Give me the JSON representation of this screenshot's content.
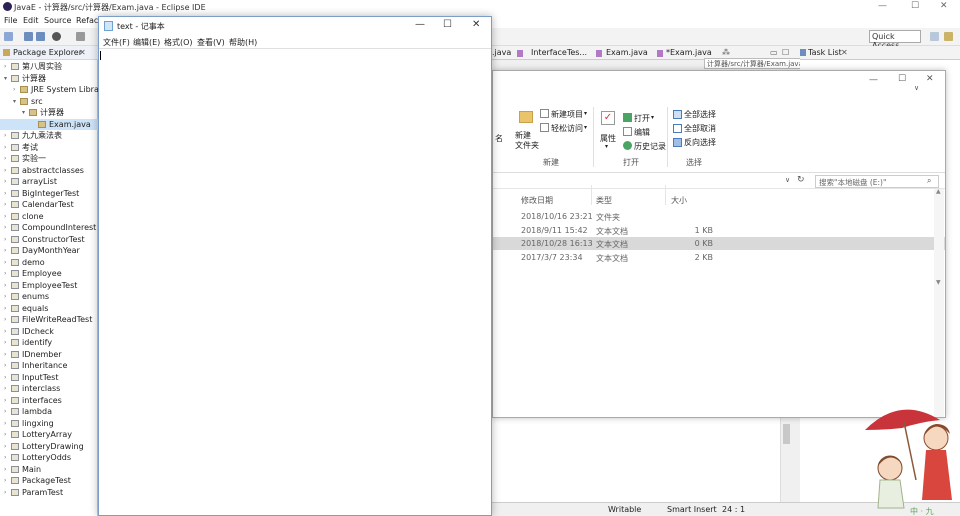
{
  "eclipse": {
    "title": "JavaE - 计算器/src/计算器/Exam.java - Eclipse IDE",
    "menu": [
      "File",
      "Edit",
      "Source",
      "Refac"
    ],
    "quick_access": "Quick Access",
    "package_explorer": {
      "title": "Package Explorer",
      "tree": [
        {
          "label": "第八周实验",
          "level": 0,
          "expanded": false
        },
        {
          "label": "计算器",
          "level": 0,
          "expanded": true
        },
        {
          "label": "JRE System Librar",
          "level": 1,
          "expanded": false
        },
        {
          "label": "src",
          "level": 1,
          "expanded": true
        },
        {
          "label": "计算器",
          "level": 2,
          "expanded": true
        },
        {
          "label": "Exam.java",
          "level": 3,
          "expanded": false,
          "selected": true
        },
        {
          "label": "九九乘法表",
          "level": 0
        },
        {
          "label": "考试",
          "level": 0
        },
        {
          "label": "实验一",
          "level": 0
        },
        {
          "label": "abstractclasses",
          "level": 0
        },
        {
          "label": "arrayList",
          "level": 0
        },
        {
          "label": "BigIntegerTest",
          "level": 0
        },
        {
          "label": "CalendarTest",
          "level": 0
        },
        {
          "label": "clone",
          "level": 0
        },
        {
          "label": "CompoundInterest",
          "level": 0
        },
        {
          "label": "ConstructorTest",
          "level": 0
        },
        {
          "label": "DayMonthYear",
          "level": 0
        },
        {
          "label": "demo",
          "level": 0
        },
        {
          "label": "Employee",
          "level": 0
        },
        {
          "label": "EmployeeTest",
          "level": 0
        },
        {
          "label": "enums",
          "level": 0
        },
        {
          "label": "equals",
          "level": 0
        },
        {
          "label": "FileWriteReadTest",
          "level": 0
        },
        {
          "label": "IDcheck",
          "level": 0
        },
        {
          "label": "identify",
          "level": 0
        },
        {
          "label": "IDnember",
          "level": 0
        },
        {
          "label": "Inheritance",
          "level": 0
        },
        {
          "label": "InputTest",
          "level": 0
        },
        {
          "label": "interclass",
          "level": 0
        },
        {
          "label": "interfaces",
          "level": 0
        },
        {
          "label": "lambda",
          "level": 0
        },
        {
          "label": "lingxing",
          "level": 0
        },
        {
          "label": "LotteryArray",
          "level": 0
        },
        {
          "label": "LotteryDrawing",
          "level": 0
        },
        {
          "label": "LotteryOdds",
          "level": 0
        },
        {
          "label": "Main",
          "level": 0
        },
        {
          "label": "PackageTest",
          "level": 0
        },
        {
          "label": "ParamTest",
          "level": 0
        }
      ]
    },
    "editor_tabs": [
      ".java",
      "InterfaceTes...",
      "Exam.java",
      "*Exam.java"
    ],
    "breadcrumb": "计算器/src/计算器/Exam.java",
    "task_list": "Task List",
    "status": {
      "writable": "Writable",
      "insert": "Smart Insert",
      "position": "24 : 1"
    }
  },
  "explorer": {
    "ribbon": {
      "rename_partial": "名",
      "new_folder": "新建\n文件夹",
      "new_item": "新建项目",
      "easy_access": "轻松访问",
      "group_new": "新建",
      "properties": "属性",
      "open": "打开",
      "edit": "编辑",
      "history": "历史记录",
      "group_open": "打开",
      "select_all": "全部选择",
      "select_none": "全部取消",
      "invert": "反向选择",
      "group_select": "选择"
    },
    "search_placeholder": "搜索\"本地磁盘 (E:)\"",
    "columns": {
      "date": "修改日期",
      "type": "类型",
      "size": "大小"
    },
    "rows": [
      {
        "date": "2018/10/16 23:21",
        "type": "文件夹",
        "size": ""
      },
      {
        "date": "2018/9/11 15:42",
        "type": "文本文档",
        "size": "1 KB"
      },
      {
        "date": "2018/10/28 16:13",
        "type": "文本文档",
        "size": "0 KB",
        "selected": true
      },
      {
        "date": "2017/3/7 23:34",
        "type": "文本文档",
        "size": "2 KB"
      }
    ]
  },
  "notepad": {
    "title": "text - 记事本",
    "menu": [
      "文件(F)",
      "编辑(E)",
      "格式(O)",
      "查看(V)",
      "帮助(H)"
    ],
    "content": ""
  },
  "colors": {
    "accent": "#0078d7",
    "selection": "#d9d9d9"
  }
}
